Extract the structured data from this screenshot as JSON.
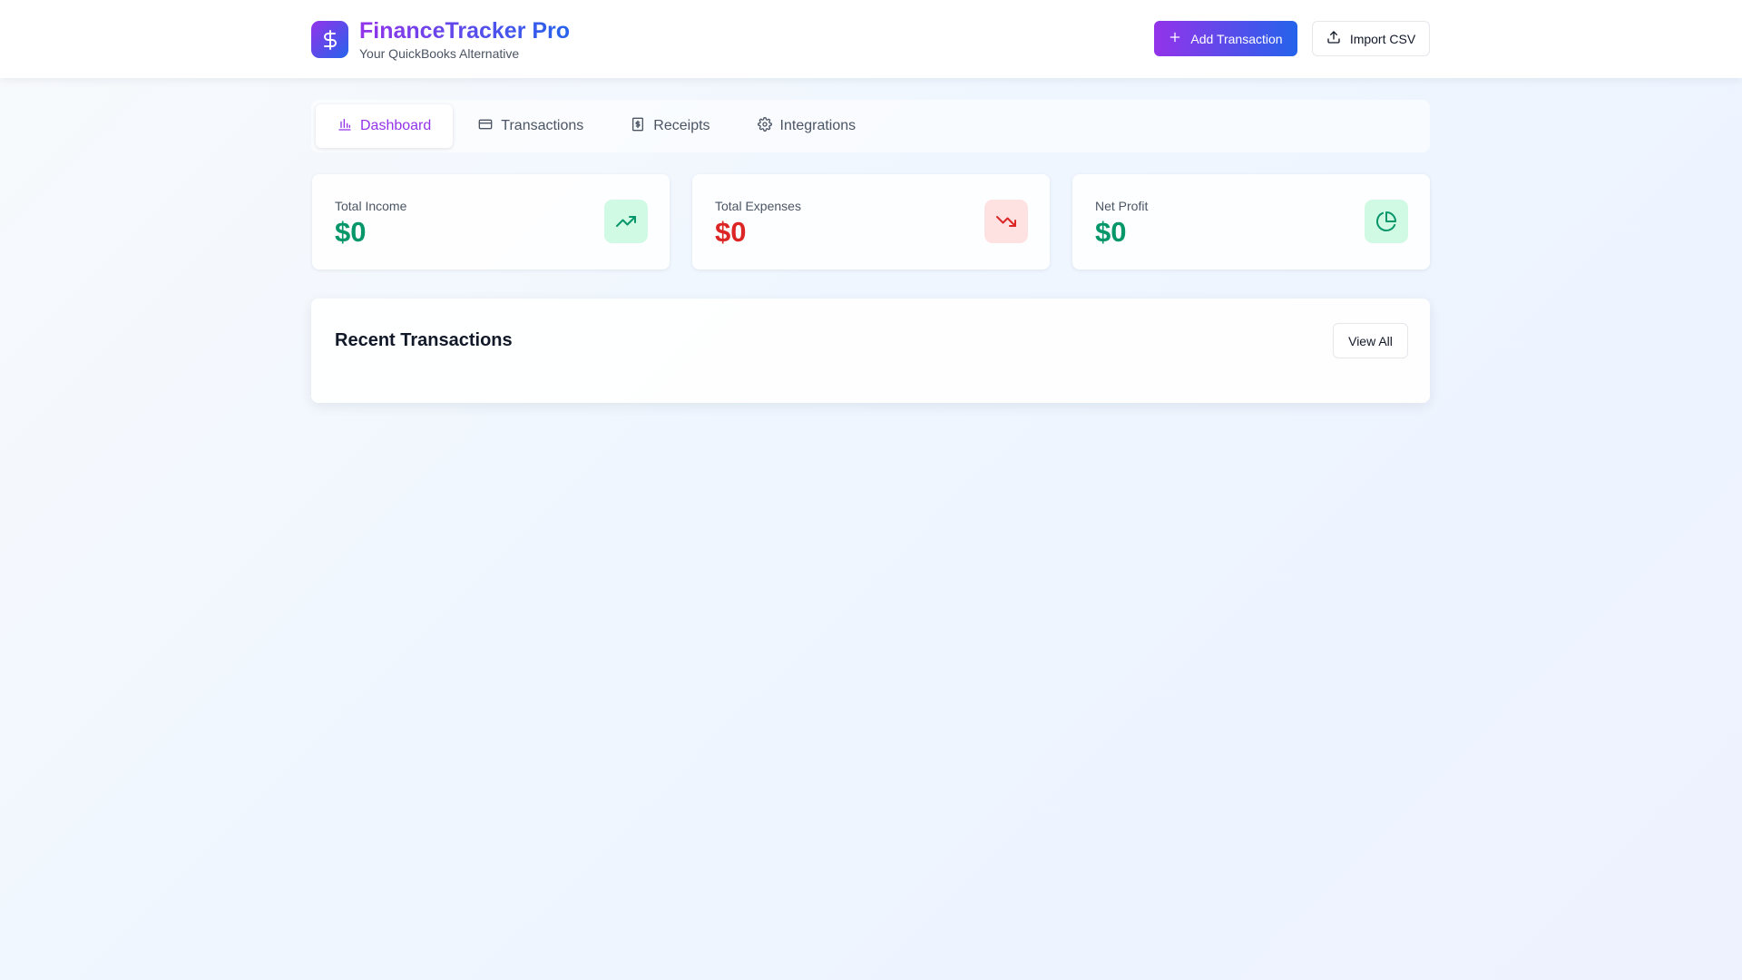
{
  "header": {
    "title": "FinanceTracker Pro",
    "subtitle": "Your QuickBooks Alternative",
    "logo_icon": "dollar-sign-icon",
    "add_button": {
      "label": "Add Transaction",
      "icon": "plus-icon"
    },
    "import_button": {
      "label": "Import CSV",
      "icon": "upload-icon"
    }
  },
  "tabs": [
    {
      "label": "Dashboard",
      "icon": "bar-chart-icon",
      "active": true
    },
    {
      "label": "Transactions",
      "icon": "credit-card-icon",
      "active": false
    },
    {
      "label": "Receipts",
      "icon": "receipt-icon",
      "active": false
    },
    {
      "label": "Integrations",
      "icon": "gear-icon",
      "active": false
    }
  ],
  "stats": [
    {
      "label": "Total Income",
      "value": "$0",
      "icon": "trending-up-icon",
      "color": "#059669",
      "icon_bg": "#d1fae5"
    },
    {
      "label": "Total Expenses",
      "value": "$0",
      "icon": "trending-down-icon",
      "color": "#dc2626",
      "icon_bg": "#fee2e2"
    },
    {
      "label": "Net Profit",
      "value": "$0",
      "icon": "pie-chart-icon",
      "color": "#059669",
      "icon_bg": "#d1fae5"
    }
  ],
  "recent": {
    "title": "Recent Transactions",
    "view_all_label": "View All"
  },
  "colors": {
    "brand_purple": "#9333ea",
    "brand_blue": "#2563eb",
    "income_green": "#059669",
    "expense_red": "#dc2626"
  }
}
